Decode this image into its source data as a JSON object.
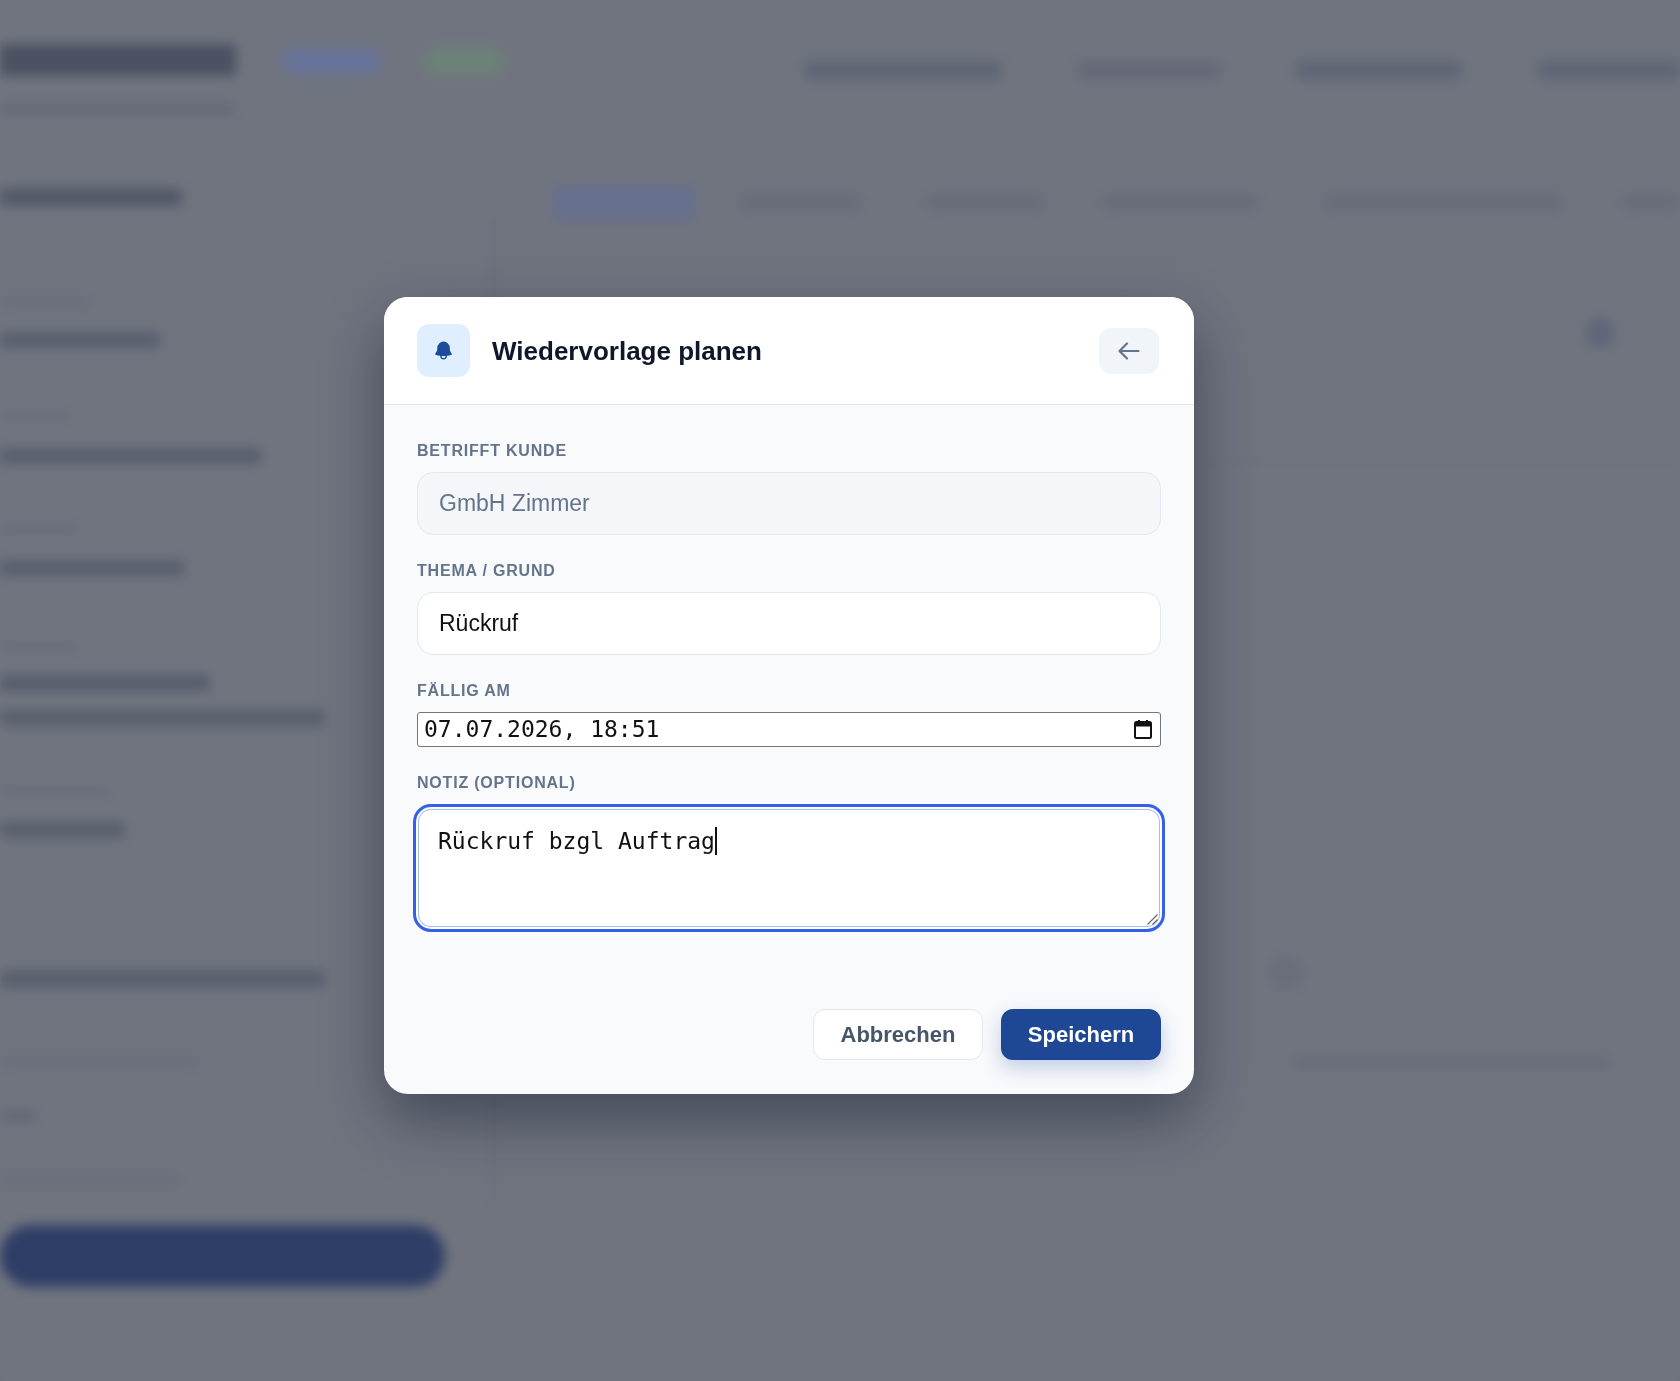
{
  "dialog": {
    "title": "Wiedervorlage planen"
  },
  "fields": [
    {
      "kind": "text",
      "label": "BETRIFFT KUNDE",
      "value": "GmbH Zimmer",
      "disabled": true,
      "focused": false
    },
    {
      "kind": "text",
      "label": "THEMA / GRUND",
      "value": "Rückruf",
      "disabled": false,
      "focused": false
    },
    {
      "kind": "datetime",
      "label": "FÄLLIG AM",
      "value": "07.07.2026, 18:51",
      "disabled": false,
      "focused": false
    },
    {
      "kind": "textarea",
      "label": "NOTIZ (OPTIONAL)",
      "value": "Rückruf bzgl Auftrag",
      "disabled": false,
      "focused": true
    }
  ],
  "buttons": [
    {
      "kind": "secondary",
      "label": "Abbrechen"
    },
    {
      "kind": "primary",
      "label": "Speichern"
    }
  ]
}
